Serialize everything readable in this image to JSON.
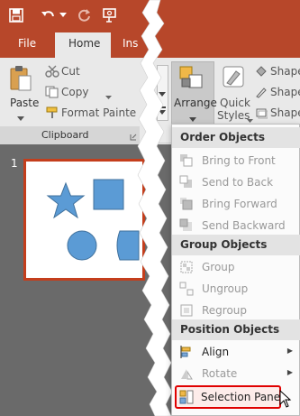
{
  "tabs": {
    "file": "File",
    "home": "Home",
    "insert_partial": "Ins"
  },
  "clipboard": {
    "paste": "Paste",
    "cut": "Cut",
    "copy": "Copy",
    "format_painter": "Format Painte",
    "group_label": "Clipboard"
  },
  "drawing": {
    "arrange": "Arrange",
    "quick_styles_line1": "Quick",
    "quick_styles_line2": "Styles",
    "shape_fill": "Shape",
    "shape_outline": "Shape",
    "shape_effects": "Shape"
  },
  "slide": {
    "number": "1"
  },
  "menu": {
    "order_header": "Order Objects",
    "bring_to_front": "Bring to Front",
    "send_to_back": "Send to Back",
    "bring_forward": "Bring Forward",
    "send_backward": "Send Backward",
    "group_header": "Group Objects",
    "group": "Group",
    "ungroup": "Ungroup",
    "regroup": "Regroup",
    "position_header": "Position Objects",
    "align": "Align",
    "rotate": "Rotate",
    "selection_pane": "Selection Pane..."
  },
  "colors": {
    "accent": "#b7472a",
    "selection_outline": "#e00000",
    "shape_fill": "#5b9bd5"
  }
}
